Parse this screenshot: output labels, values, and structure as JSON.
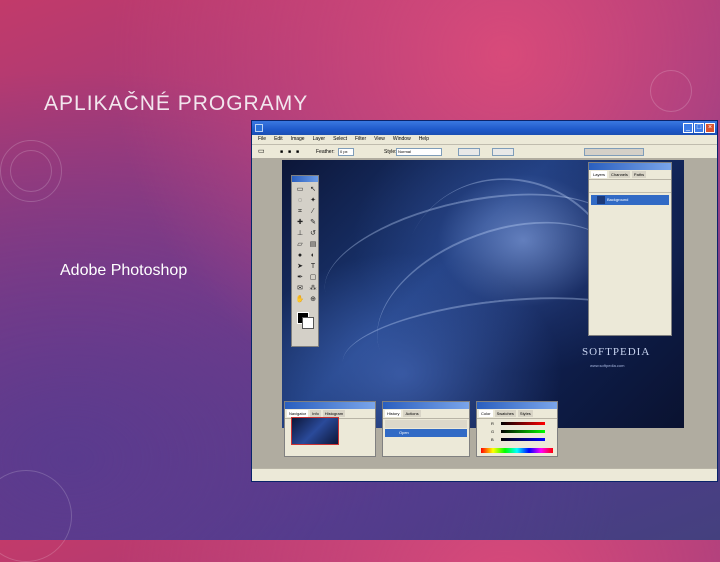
{
  "slide": {
    "title": "APLIKAČNÉ PROGRAMY",
    "subtitle": "Adobe Photoshop"
  },
  "colors": {
    "background_top": "#c23a6a",
    "background_bottom": "#44407e",
    "xp_titlebar": "#1f5acb",
    "selection": "#316ac5"
  },
  "screenshot": {
    "menu": [
      "File",
      "Edit",
      "Image",
      "Layer",
      "Select",
      "Filter",
      "View",
      "Window",
      "Help"
    ],
    "options": {
      "feather_label": "Feather:",
      "feather_value": "0 px",
      "style_label": "Style:",
      "style_value": "Normal"
    },
    "canvas": {
      "watermark": "SOFTPEDIA",
      "watermark_url": "www.softpedia.com"
    },
    "layers_panel": {
      "tabs": [
        "Layers",
        "Channels",
        "Paths"
      ],
      "layer_name": "Background"
    },
    "navigator_panel": {
      "tabs": [
        "Navigator",
        "Info",
        "Histogram"
      ]
    },
    "history_panel": {
      "tabs": [
        "History",
        "Actions"
      ],
      "rows": [
        "Open"
      ]
    },
    "color_panel": {
      "tabs": [
        "Color",
        "Swatches",
        "Styles"
      ],
      "channels": [
        "R",
        "G",
        "B"
      ]
    }
  }
}
